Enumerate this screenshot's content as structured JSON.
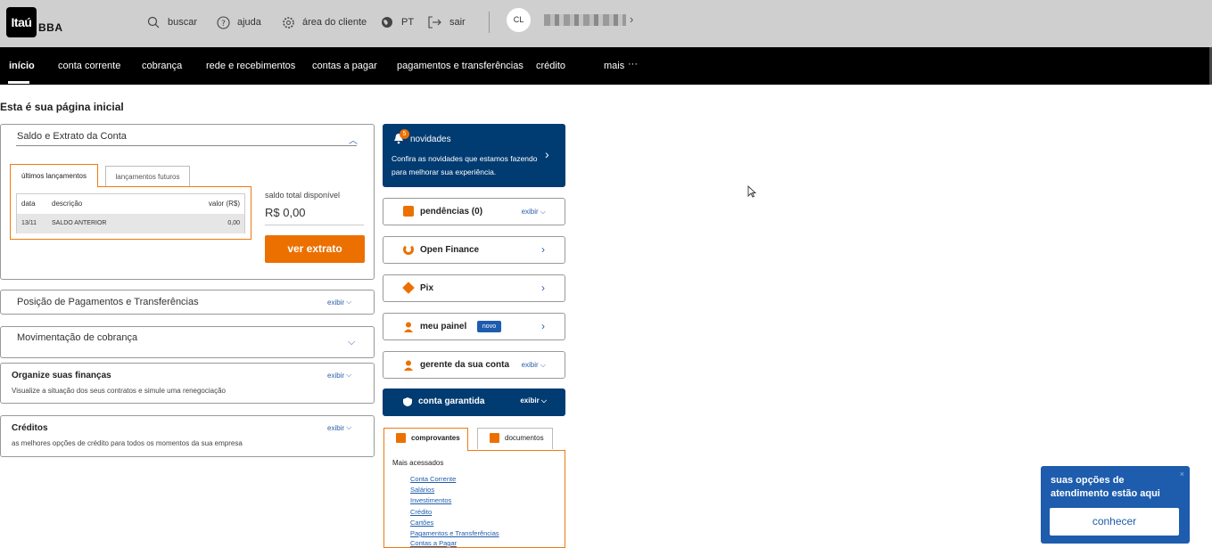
{
  "brand": {
    "logo": "Itaú",
    "sub": "BBA"
  },
  "topbar": {
    "search": "buscar",
    "help": "ajuda",
    "client_area": "área do cliente",
    "language": "PT",
    "logout": "sair",
    "avatar_initials": "CL"
  },
  "nav": {
    "items": [
      "início",
      "conta corrente",
      "cobrança",
      "rede e recebimentos",
      "contas a pagar",
      "pagamentos e transferências",
      "crédito",
      "mais"
    ],
    "more_icon": "···"
  },
  "page_title": "Esta é sua página inicial",
  "saldo": {
    "title": "Saldo e Extrato da Conta",
    "tabs": [
      "últimos lançamentos",
      "lançamentos futuros"
    ],
    "table": {
      "headers": [
        "data",
        "descrição",
        "valor (R$)"
      ],
      "rows": [
        {
          "data": "13/11",
          "descricao": "SALDO ANTERIOR",
          "valor": "0,00"
        }
      ]
    },
    "total_label": "saldo total disponível",
    "total_value": "R$ 0,00",
    "button": "ver extrato"
  },
  "sections": {
    "pagamentos": {
      "title": "Posição de Pagamentos e Transferências",
      "action": "exibir"
    },
    "cobranca": {
      "title": "Movimentação de cobrança"
    },
    "financas": {
      "title": "Organize suas finanças",
      "subtitle": "Visualize a situação dos seus contratos e simule uma renegociação",
      "action": "exibir"
    },
    "creditos": {
      "title": "Créditos",
      "subtitle": "as melhores opções de crédito para todos os momentos da sua empresa",
      "action": "exibir"
    }
  },
  "novidades": {
    "badge": "5",
    "title": "novidades",
    "text": "Confira as novidades que estamos fazendo para melhorar sua experiência."
  },
  "quick": {
    "pendencias": {
      "label": "pendências (0)",
      "action": "exibir"
    },
    "open_finance": {
      "label": "Open Finance"
    },
    "pix": {
      "label": "Pix"
    },
    "meu_painel": {
      "label": "meu painel",
      "badge": "novo"
    },
    "gerente": {
      "label": "gerente da sua conta",
      "action": "exibir"
    },
    "garantida": {
      "label": "conta garantida",
      "action": "exibir"
    }
  },
  "comprovantes": {
    "tabs": [
      "comprovantes",
      "documentos"
    ],
    "heading": "Mais acessados",
    "links": [
      "Conta Corrente",
      "Salários",
      "Investimentos",
      "Crédito",
      "Cartões",
      "Pagamentos e Transferências",
      "Contas a Pagar"
    ]
  },
  "help_widget": {
    "text": "suas opções de atendimento estão aqui",
    "button": "conhecer",
    "close": "×"
  },
  "colors": {
    "accent": "#ec7000",
    "brand_blue": "#003b72",
    "link_blue": "#1e5cad"
  }
}
